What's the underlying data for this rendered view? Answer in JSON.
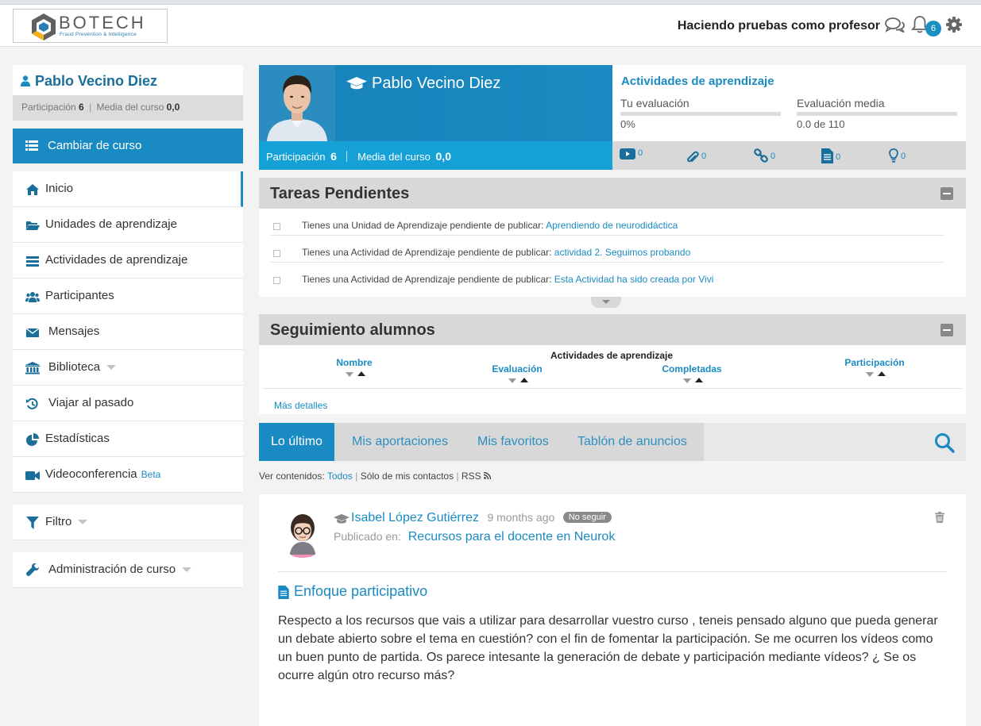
{
  "header": {
    "logo_text": "BOTECH",
    "logo_subtitle": "Fraud Prevention & Intelligence",
    "user_label": "Haciendo pruebas como profesor",
    "notification_count": "6",
    "accent_color": "#1a8bc2"
  },
  "sidebar": {
    "user_name": "Pablo Vecino Diez",
    "participation_label": "Participación",
    "participation_value": "6",
    "average_label": "Media del curso",
    "average_value": "0,0",
    "change_course": "Cambiar de curso",
    "items": [
      {
        "label": "Inicio",
        "icon": "home-icon"
      },
      {
        "label": "Unidades de aprendizaje",
        "icon": "folder-open-icon"
      },
      {
        "label": "Actividades de aprendizaje",
        "icon": "list-bars-icon"
      },
      {
        "label": "Participantes",
        "icon": "users-icon"
      },
      {
        "label": "Mensajes",
        "icon": "envelope-icon"
      },
      {
        "label": "Biblioteca",
        "icon": "bank-icon"
      },
      {
        "label": "Viajar al pasado",
        "icon": "history-icon"
      },
      {
        "label": "Estadísticas",
        "icon": "pie-chart-icon"
      },
      {
        "label": "Videoconferencia",
        "icon": "video-camera-icon",
        "badge": "Beta"
      }
    ],
    "filter_label": "Filtro",
    "admin_label": "Administración de curso"
  },
  "profile": {
    "name": "Pablo Vecino Diez",
    "participation_label": "Participación",
    "participation_value": "6",
    "average_label": "Media del curso",
    "average_value": "0,0"
  },
  "activities": {
    "title": "Actividades de aprendizaje",
    "own_label": "Tu evaluación",
    "own_value": "0%",
    "avg_label": "Evaluación media",
    "avg_value": "0.0 de 110",
    "counts": [
      {
        "icon": "youtube-play-icon",
        "value": "0"
      },
      {
        "icon": "paperclip-icon",
        "value": "0"
      },
      {
        "icon": "link-icon",
        "value": "0"
      },
      {
        "icon": "document-icon",
        "value": "0"
      },
      {
        "icon": "lightbulb-icon",
        "value": "0"
      }
    ]
  },
  "pending": {
    "title": "Tareas Pendientes",
    "tasks": [
      {
        "text": "Tienes una Unidad de Aprendizaje pendiente de publicar:",
        "link": "Aprendiendo de neurodidáctica"
      },
      {
        "text": "Tienes una Actividad de Aprendizaje pendiente de publicar:",
        "link": "actividad 2. Seguimos probando"
      },
      {
        "text": "Tienes una Actividad de Aprendizaje pendiente de publicar:",
        "link": "Esta Actividad ha sido creada por Vivi"
      }
    ]
  },
  "tracking": {
    "title": "Seguimiento alumnos",
    "group_header": "Actividades de aprendizaje",
    "col_name": "Nombre",
    "col_eval": "Evaluación",
    "col_done": "Completadas",
    "col_part": "Participación",
    "more": "Más detalles"
  },
  "tabs": [
    "Lo último",
    "Mis aportaciones",
    "Mis favoritos",
    "Tablón de anuncios"
  ],
  "filter": {
    "prefix": "Ver contenidos:",
    "all": "Todos",
    "contacts": "Sólo de mis contactos",
    "rss": "RSS"
  },
  "post": {
    "author": "Isabel López Gutiérrez",
    "time": "9 months ago",
    "badge": "No seguir",
    "published_in_label": "Publicado en:",
    "published_in": "Recursos para el docente en Neurok",
    "title": "Enfoque participativo",
    "body": "Respecto a los recursos que vais a utilizar para desarrollar vuestro curso , teneis pensado alguno que pueda generar un debate abierto sobre el tema en cuestión? con el fin de fomentar la participación. Se me ocurren los vídeos como un buen punto de partida. Os parece intesante la generación de debate y participación mediante vídeos? ¿ Se os ocurre algún otro recurso más?"
  }
}
